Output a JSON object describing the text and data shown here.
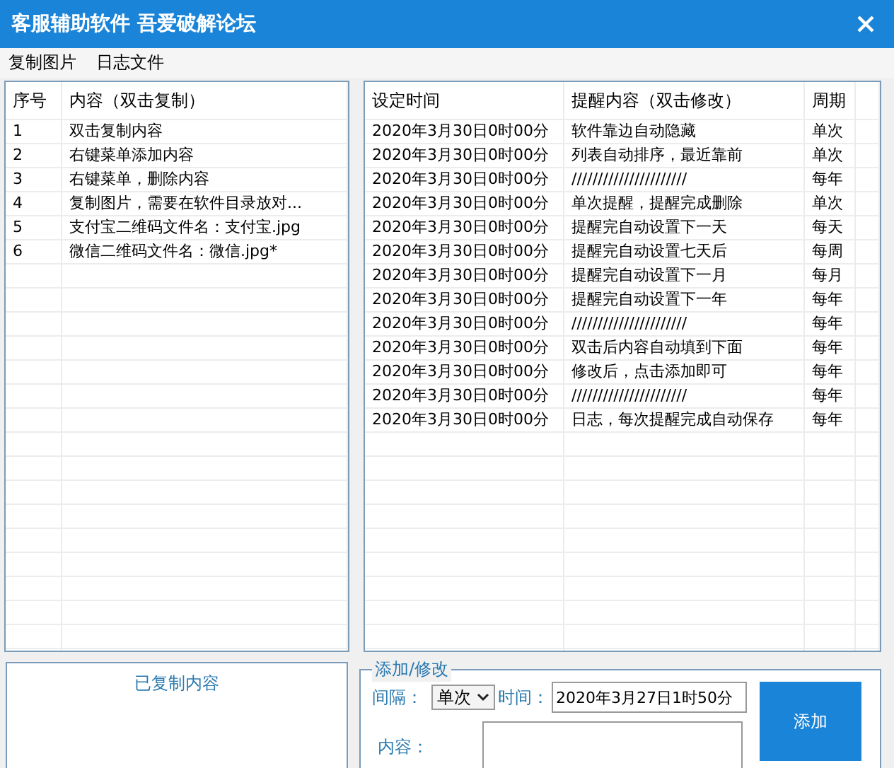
{
  "window": {
    "title": "客服辅助软件 吾爱破解论坛"
  },
  "menu": [
    "复制图片",
    "日志文件"
  ],
  "copy_list": {
    "columns": [
      "序号",
      "内容（双击复制）"
    ],
    "rows": [
      [
        "1",
        "双击复制内容"
      ],
      [
        "2",
        "右键菜单添加内容"
      ],
      [
        "3",
        "右键菜单，删除内容"
      ],
      [
        "4",
        "复制图片，需要在软件目录放对..."
      ],
      [
        "5",
        "支付宝二维码文件名：支付宝.jpg"
      ],
      [
        "6",
        "微信二维码文件名：微信.jpg*"
      ]
    ]
  },
  "reminders": {
    "columns": [
      "设定时间",
      "提醒内容（双击修改）",
      "周期"
    ],
    "rows": [
      [
        "2020年3月30日0时00分",
        "软件靠边自动隐藏",
        "单次"
      ],
      [
        "2020年3月30日0时00分",
        "列表自动排序，最近靠前",
        "单次"
      ],
      [
        "2020年3月30日0时00分",
        "//////////////////////",
        "每年"
      ],
      [
        "2020年3月30日0时00分",
        "单次提醒，提醒完成删除",
        "单次"
      ],
      [
        "2020年3月30日0时00分",
        "提醒完自动设置下一天",
        "每天"
      ],
      [
        "2020年3月30日0时00分",
        "提醒完自动设置七天后",
        "每周"
      ],
      [
        "2020年3月30日0时00分",
        "提醒完自动设置下一月",
        "每月"
      ],
      [
        "2020年3月30日0时00分",
        "提醒完自动设置下一年",
        "每年"
      ],
      [
        "2020年3月30日0时00分",
        "//////////////////////",
        "每年"
      ],
      [
        "2020年3月30日0时00分",
        "双击后内容自动填到下面",
        "每年"
      ],
      [
        "2020年3月30日0时00分",
        "修改后，点击添加即可",
        "每年"
      ],
      [
        "2020年3月30日0时00分",
        "//////////////////////",
        "每年"
      ],
      [
        "2020年3月30日0时00分",
        "日志，每次提醒完成自动保存",
        "每年"
      ]
    ]
  },
  "copied_panel": {
    "title": "已复制内容"
  },
  "add_form": {
    "legend": "添加/修改",
    "interval_label": "间隔：",
    "interval_value": "单次",
    "time_label": "时间：",
    "time_value": "2020年3月27日1时50分",
    "content_label": "内容：",
    "add_button": "添加"
  }
}
